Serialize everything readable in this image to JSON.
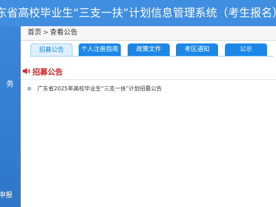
{
  "header": {
    "title": "东省高校毕业生“三支一扶”计划信息管理系统（考生报名）"
  },
  "sidebar": {
    "item_a": "务",
    "item_b": "申报"
  },
  "breadcrumb": {
    "home": "首页",
    "separator": ">",
    "current": "查看公告"
  },
  "tabs": [
    {
      "label": "招募公告",
      "active": true
    },
    {
      "label": "个人注册指南",
      "active": false
    },
    {
      "label": "政策文件",
      "active": false
    },
    {
      "label": "考区通知",
      "active": false
    },
    {
      "label": "公示",
      "active": false
    }
  ],
  "notice": {
    "title": "招募公告",
    "items": [
      {
        "text": "广东省2025年高校毕业生“三支一扶”计划招募公告"
      }
    ]
  },
  "colors": {
    "header_bg": "#3f8ee0",
    "tab_bg": "#1c87e6",
    "tab_active_bg": "#dff0fc",
    "notice_title": "#cf2a2a"
  }
}
